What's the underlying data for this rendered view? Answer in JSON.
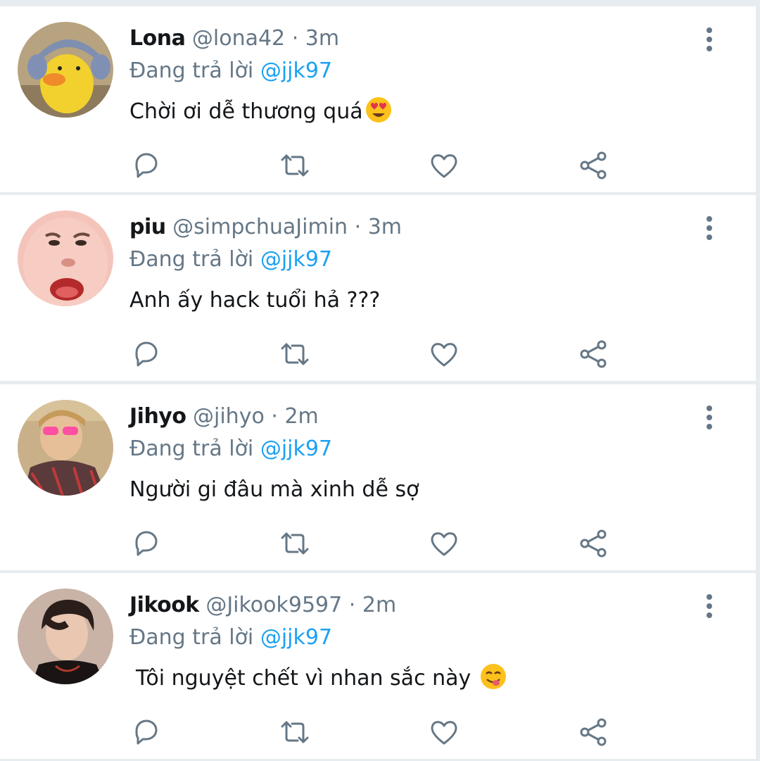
{
  "reply_prefix": "Đang trả lời",
  "tweets": [
    {
      "name": "Lona",
      "handle": "@lona42",
      "time": "3m",
      "reply_to": "@jjk97",
      "text": "Chời ơi dễ thương quá",
      "emoji": "heart-eyes-emoji"
    },
    {
      "name": "piu",
      "handle": "@simpchuaJimin",
      "time": "3m",
      "reply_to": "@jjk97",
      "text": "Anh ấy hack tuổi hả ???",
      "emoji": ""
    },
    {
      "name": "Jihyo",
      "handle": "@jihyo",
      "time": "2m",
      "reply_to": "@jjk97",
      "text": "Người gi đâu mà xinh dễ sợ",
      "emoji": ""
    },
    {
      "name": "Jikook",
      "handle": "@Jikook9597",
      "time": "2m",
      "reply_to": "@jjk97",
      "text": "Tôi nguyệt chết vì nhan sắc này",
      "emoji": "yum-face-emoji"
    }
  ],
  "colors": {
    "mention": "#1da1f2",
    "muted": "#657786",
    "text": "#14171a",
    "divider": "#e6ecf0"
  },
  "icons": [
    "reply-icon",
    "retweet-icon",
    "like-icon",
    "share-icon",
    "more-options-icon"
  ]
}
